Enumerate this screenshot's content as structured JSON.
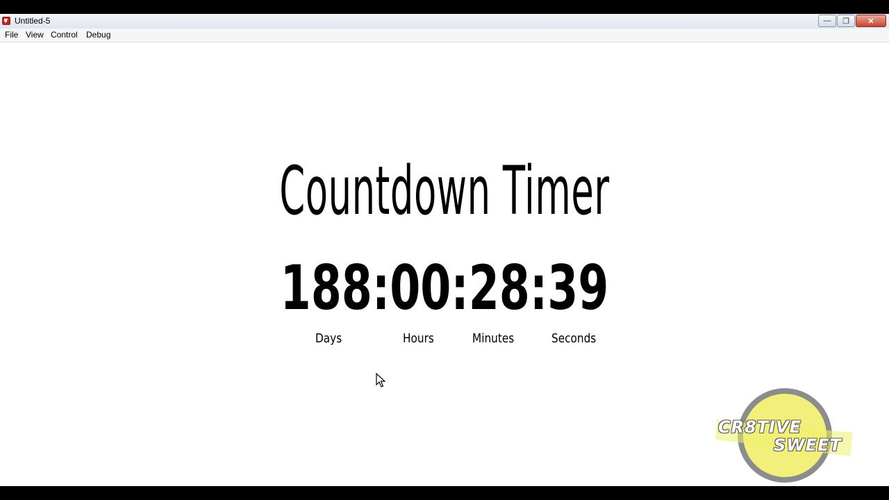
{
  "window": {
    "title": "Untitled-5",
    "close_glyph": "✕",
    "minimize_glyph": "—",
    "maximize_glyph": "❐"
  },
  "menu": [
    "File",
    "View",
    "Control",
    "Debug"
  ],
  "countdown": {
    "heading": "Countdown Timer",
    "time": "188:00:28:39",
    "units": [
      "Days",
      "Hours",
      "Minutes",
      "Seconds"
    ]
  },
  "logo": {
    "line1": "CR8TIVE",
    "line2": "SWEET",
    "circle_color": "#f2f07a",
    "ring_color": "#8c8c8c",
    "band_color": "#eef06c"
  },
  "icons": {
    "app": "flash-player-icon",
    "cursor": "mouse-pointer-icon"
  }
}
